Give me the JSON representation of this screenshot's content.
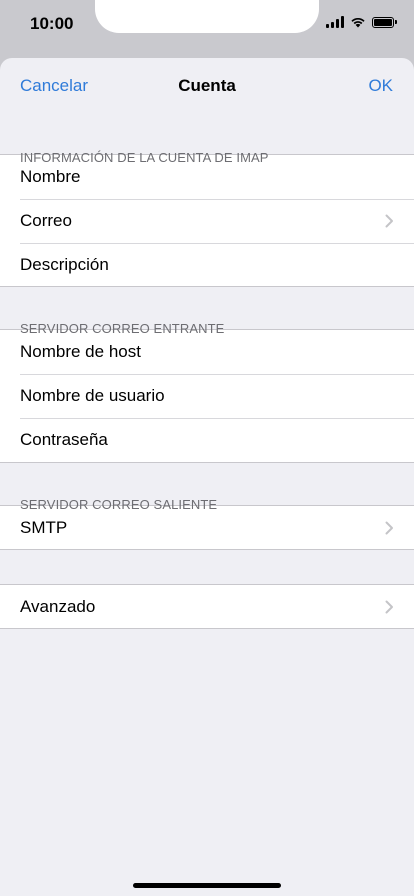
{
  "status": {
    "time": "10:00",
    "icons": [
      "signal-icon",
      "wifi-icon",
      "battery-icon"
    ]
  },
  "nav": {
    "cancel": "Cancelar",
    "title": "Cuenta",
    "ok": "OK",
    "accent_color": "#2f7bd9"
  },
  "sections": {
    "imap": {
      "header": "INFORMACIÓN DE LA CUENTA DE IMAP",
      "rows": [
        {
          "label": "Nombre"
        },
        {
          "label": "Correo",
          "chevron": true
        },
        {
          "label": "Descripción"
        }
      ]
    },
    "incoming": {
      "header": "SERVIDOR CORREO ENTRANTE",
      "rows": [
        {
          "label": "Nombre de host"
        },
        {
          "label": "Nombre de usuario"
        },
        {
          "label": "Contraseña"
        }
      ]
    },
    "outgoing": {
      "header": "SERVIDOR CORREO SALIENTE",
      "rows": [
        {
          "label": "SMTP",
          "chevron": true
        }
      ]
    },
    "advanced": {
      "rows": [
        {
          "label": "Avanzado",
          "chevron": true
        }
      ]
    }
  }
}
